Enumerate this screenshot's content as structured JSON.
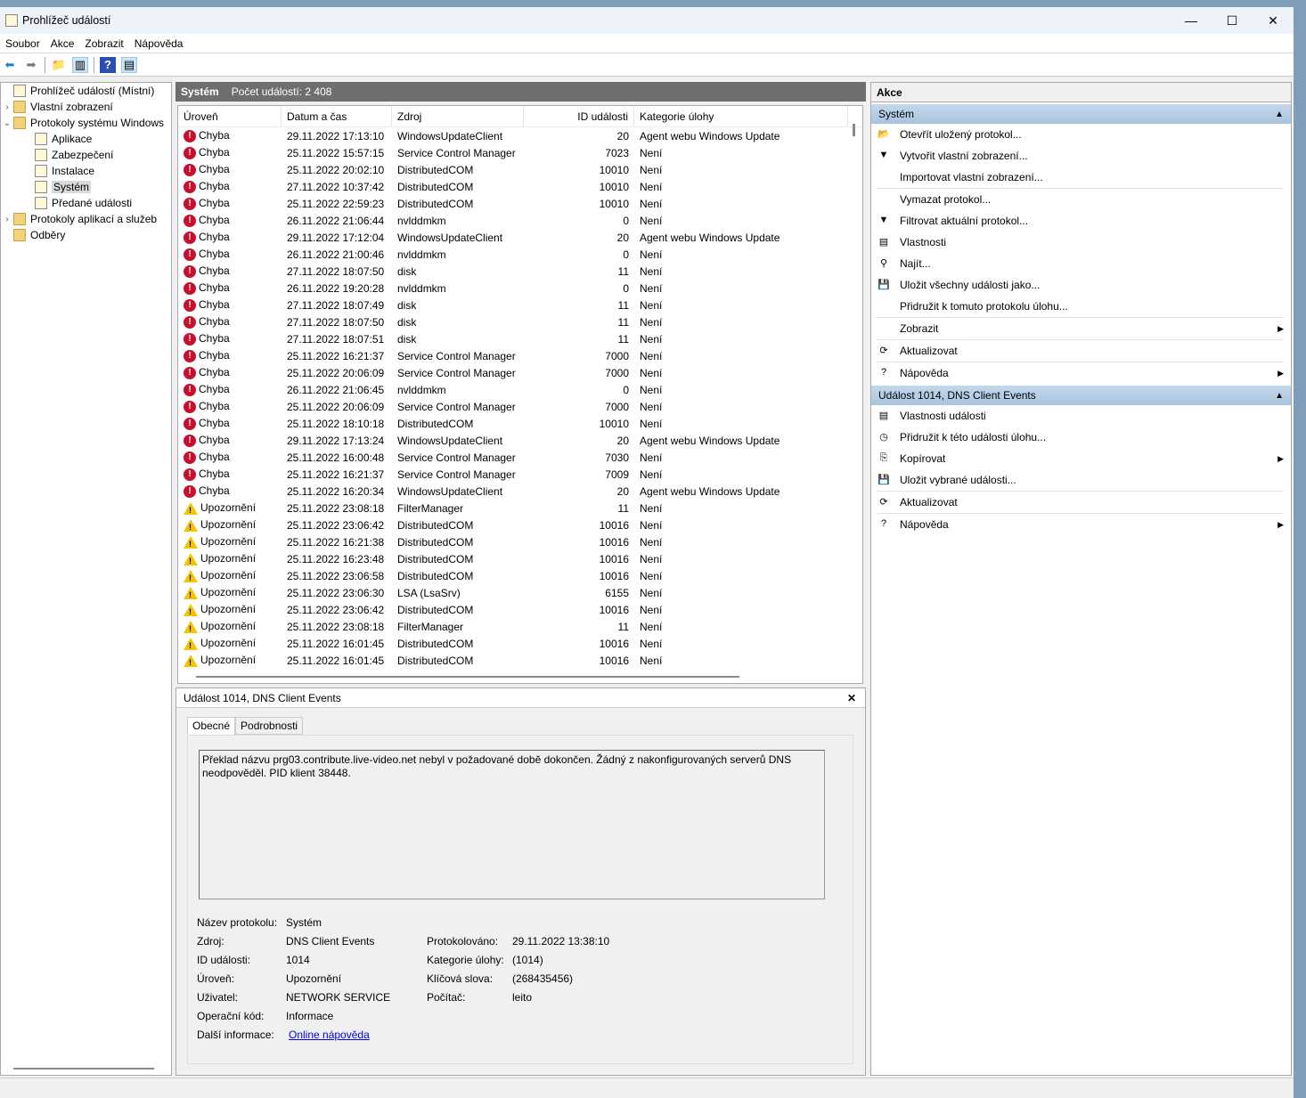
{
  "window": {
    "title": "Prohlížeč událostí",
    "min": "—",
    "max": "☐",
    "close": "✕"
  },
  "menu": [
    "Soubor",
    "Akce",
    "Zobrazit",
    "Nápověda"
  ],
  "tree": [
    {
      "label": "Prohlížeč událostí (Místní)",
      "indent": 0,
      "chev": "",
      "icon": "log"
    },
    {
      "label": "Vlastní zobrazení",
      "indent": 0,
      "chev": "›",
      "icon": "folder"
    },
    {
      "label": "Protokoly systému Windows",
      "indent": 0,
      "chev": "⌄",
      "icon": "folder"
    },
    {
      "label": "Aplikace",
      "indent": 1,
      "chev": "",
      "icon": "log"
    },
    {
      "label": "Zabezpečení",
      "indent": 1,
      "chev": "",
      "icon": "log"
    },
    {
      "label": "Instalace",
      "indent": 1,
      "chev": "",
      "icon": "log"
    },
    {
      "label": "Systém",
      "indent": 1,
      "chev": "",
      "icon": "log",
      "selected": true
    },
    {
      "label": "Předané události",
      "indent": 1,
      "chev": "",
      "icon": "log"
    },
    {
      "label": "Protokoly aplikací a služeb",
      "indent": 0,
      "chev": "›",
      "icon": "folder"
    },
    {
      "label": "Odběry",
      "indent": 0,
      "chev": "",
      "icon": "folder"
    }
  ],
  "center": {
    "title": "Systém",
    "count": "Počet událostí: 2 408",
    "columns": [
      "Úroveň",
      "Datum a čas",
      "Zdroj",
      "ID události",
      "Kategorie úlohy"
    ],
    "rows": [
      [
        "Chyba",
        "29.11.2022 17:13:10",
        "WindowsUpdateClient",
        "20",
        "Agent webu Windows Update"
      ],
      [
        "Chyba",
        "25.11.2022 15:57:15",
        "Service Control Manager",
        "7023",
        "Není"
      ],
      [
        "Chyba",
        "25.11.2022 20:02:10",
        "DistributedCOM",
        "10010",
        "Není"
      ],
      [
        "Chyba",
        "27.11.2022 10:37:42",
        "DistributedCOM",
        "10010",
        "Není"
      ],
      [
        "Chyba",
        "25.11.2022 22:59:23",
        "DistributedCOM",
        "10010",
        "Není"
      ],
      [
        "Chyba",
        "26.11.2022 21:06:44",
        "nvlddmkm",
        "0",
        "Není"
      ],
      [
        "Chyba",
        "29.11.2022 17:12:04",
        "WindowsUpdateClient",
        "20",
        "Agent webu Windows Update"
      ],
      [
        "Chyba",
        "26.11.2022 21:00:46",
        "nvlddmkm",
        "0",
        "Není"
      ],
      [
        "Chyba",
        "27.11.2022 18:07:50",
        "disk",
        "11",
        "Není"
      ],
      [
        "Chyba",
        "26.11.2022 19:20:28",
        "nvlddmkm",
        "0",
        "Není"
      ],
      [
        "Chyba",
        "27.11.2022 18:07:49",
        "disk",
        "11",
        "Není"
      ],
      [
        "Chyba",
        "27.11.2022 18:07:50",
        "disk",
        "11",
        "Není"
      ],
      [
        "Chyba",
        "27.11.2022 18:07:51",
        "disk",
        "11",
        "Není"
      ],
      [
        "Chyba",
        "25.11.2022 16:21:37",
        "Service Control Manager",
        "7000",
        "Není"
      ],
      [
        "Chyba",
        "25.11.2022 20:06:09",
        "Service Control Manager",
        "7000",
        "Není"
      ],
      [
        "Chyba",
        "26.11.2022 21:06:45",
        "nvlddmkm",
        "0",
        "Není"
      ],
      [
        "Chyba",
        "25.11.2022 20:06:09",
        "Service Control Manager",
        "7000",
        "Není"
      ],
      [
        "Chyba",
        "25.11.2022 18:10:18",
        "DistributedCOM",
        "10010",
        "Není"
      ],
      [
        "Chyba",
        "29.11.2022 17:13:24",
        "WindowsUpdateClient",
        "20",
        "Agent webu Windows Update"
      ],
      [
        "Chyba",
        "25.11.2022 16:00:48",
        "Service Control Manager",
        "7030",
        "Není"
      ],
      [
        "Chyba",
        "25.11.2022 16:21:37",
        "Service Control Manager",
        "7009",
        "Není"
      ],
      [
        "Chyba",
        "25.11.2022 16:20:34",
        "WindowsUpdateClient",
        "20",
        "Agent webu Windows Update"
      ],
      [
        "Upozornění",
        "25.11.2022 23:08:18",
        "FilterManager",
        "11",
        "Není"
      ],
      [
        "Upozornění",
        "25.11.2022 23:06:42",
        "DistributedCOM",
        "10016",
        "Není"
      ],
      [
        "Upozornění",
        "25.11.2022 16:21:38",
        "DistributedCOM",
        "10016",
        "Není"
      ],
      [
        "Upozornění",
        "25.11.2022 16:23:48",
        "DistributedCOM",
        "10016",
        "Není"
      ],
      [
        "Upozornění",
        "25.11.2022 23:06:58",
        "DistributedCOM",
        "10016",
        "Není"
      ],
      [
        "Upozornění",
        "25.11.2022 23:06:30",
        "LSA (LsaSrv)",
        "6155",
        "Není"
      ],
      [
        "Upozornění",
        "25.11.2022 23:06:42",
        "DistributedCOM",
        "10016",
        "Není"
      ],
      [
        "Upozornění",
        "25.11.2022 23:08:18",
        "FilterManager",
        "11",
        "Není"
      ],
      [
        "Upozornění",
        "25.11.2022 16:01:45",
        "DistributedCOM",
        "10016",
        "Není"
      ],
      [
        "Upozornění",
        "25.11.2022 16:01:45",
        "DistributedCOM",
        "10016",
        "Není"
      ]
    ]
  },
  "details": {
    "title": "Událost 1014, DNS Client Events",
    "close": "✕",
    "tabs": [
      "Obecné",
      "Podrobnosti"
    ],
    "message": "Překlad názvu prg03.contribute.live-video.net nebyl v požadované době dokončen. Žádný z nakonfigurovaných serverů DNS neodpověděl. PID klient 38448.",
    "props": {
      "log_name_label": "Název protokolu:",
      "log_name": "Systém",
      "source_label": "Zdroj:",
      "source": "DNS Client Events",
      "logged_label": "Protokolováno:",
      "logged": "29.11.2022 13:38:10",
      "id_label": "ID události:",
      "id": "1014",
      "task_label": "Kategorie úlohy:",
      "task": "(1014)",
      "level_label": "Úroveň:",
      "level": "Upozornění",
      "keywords_label": "Klíčová slova:",
      "keywords": "(268435456)",
      "user_label": "Uživatel:",
      "user": "NETWORK SERVICE",
      "computer_label": "Počítač:",
      "computer": "leito",
      "opcode_label": "Operační kód:",
      "opcode": "Informace",
      "more_label": "Další informace:",
      "more_link": "Online nápověda"
    }
  },
  "actions": {
    "title": "Akce",
    "sections": [
      {
        "title": "Systém",
        "items": [
          {
            "label": "Otevřít uložený protokol...",
            "icon": "📂"
          },
          {
            "label": "Vytvořit vlastní zobrazení...",
            "icon": "▼"
          },
          {
            "label": "Importovat vlastní zobrazení...",
            "icon": "",
            "divider": true
          },
          {
            "label": "Vymazat protokol...",
            "icon": ""
          },
          {
            "label": "Filtrovat aktuální protokol...",
            "icon": "▼"
          },
          {
            "label": "Vlastnosti",
            "icon": "▤"
          },
          {
            "label": "Najít...",
            "icon": "⚲"
          },
          {
            "label": "Uložit všechny události jako...",
            "icon": "💾"
          },
          {
            "label": "Přidružit k tomuto protokolu úlohu...",
            "icon": "",
            "divider": true
          },
          {
            "label": "Zobrazit",
            "icon": "",
            "sub": true,
            "divider": true
          },
          {
            "label": "Aktualizovat",
            "icon": "⟳",
            "divider": true
          },
          {
            "label": "Nápověda",
            "icon": "?",
            "sub": true
          }
        ]
      },
      {
        "title": "Událost 1014, DNS Client Events",
        "items": [
          {
            "label": "Vlastnosti události",
            "icon": "▤"
          },
          {
            "label": "Přidružit k této události úlohu...",
            "icon": "◷"
          },
          {
            "label": "Kopírovat",
            "icon": "⎘",
            "sub": true
          },
          {
            "label": "Uložit vybrané události...",
            "icon": "💾",
            "divider": true
          },
          {
            "label": "Aktualizovat",
            "icon": "⟳",
            "divider": true
          },
          {
            "label": "Nápověda",
            "icon": "?",
            "sub": true
          }
        ]
      }
    ]
  },
  "colors": {
    "error": "#c8102e",
    "warning": "#f5c400",
    "section": "#b8cfe6",
    "link": "#0000ee"
  }
}
